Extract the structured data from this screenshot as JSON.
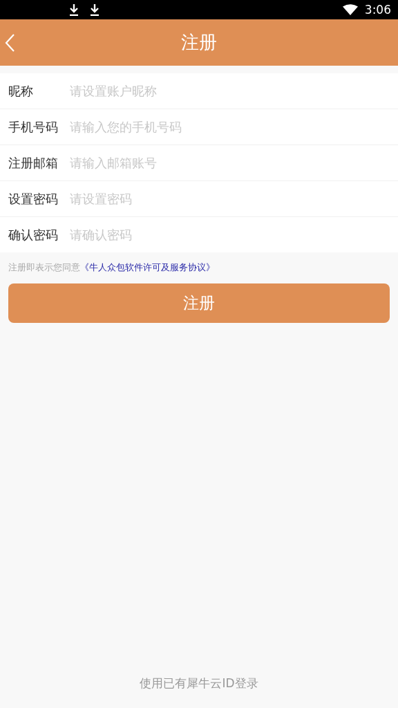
{
  "status_bar": {
    "time": "3:06"
  },
  "header": {
    "title": "注册"
  },
  "fields": [
    {
      "label": "昵称",
      "placeholder": "请设置账户昵称"
    },
    {
      "label": "手机号码",
      "placeholder": "请输入您的手机号码"
    },
    {
      "label": "注册邮箱",
      "placeholder": "请输入邮箱账号"
    },
    {
      "label": "设置密码",
      "placeholder": "请设置密码"
    },
    {
      "label": "确认密码",
      "placeholder": "请确认密码"
    }
  ],
  "agreement": {
    "text": "注册即表示您同意",
    "link": "《牛人众包软件许可及服务协议》"
  },
  "submit_button": "注册",
  "login_link": "使用已有犀牛云ID登录"
}
